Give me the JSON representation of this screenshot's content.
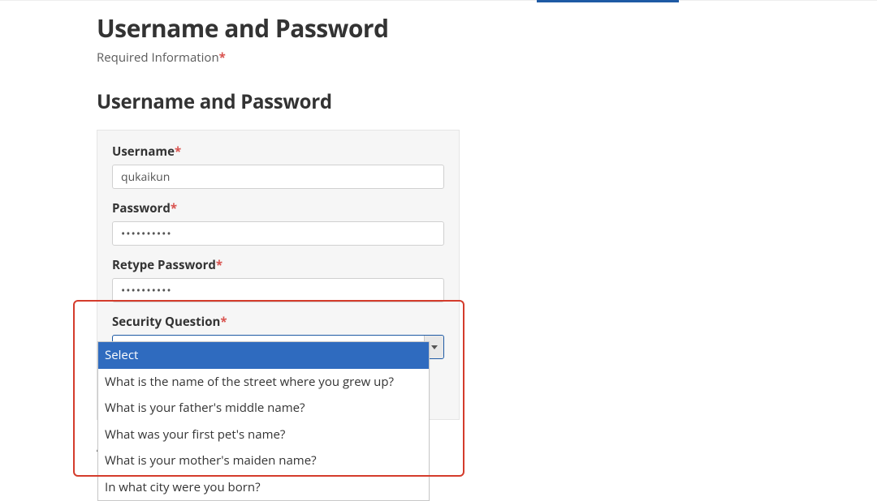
{
  "page": {
    "title": "Username and Password",
    "required_label": "Required Information"
  },
  "section": {
    "title": "Username and Password"
  },
  "form": {
    "username": {
      "label": "Username",
      "value": "qukaikun"
    },
    "password": {
      "label": "Password",
      "value": "••••••••••"
    },
    "retype_password": {
      "label": "Retype Password",
      "value": "••••••••••"
    },
    "security_question": {
      "label": "Security Question",
      "selected": "Select",
      "options": [
        "Select",
        "What is the name of the street where you grew up?",
        "What is your father's middle name?",
        "What was your first pet's name?",
        "What is your mother's maiden name?",
        "In what city were you born?"
      ]
    }
  },
  "below": {
    "heading_partial": "Ac"
  }
}
